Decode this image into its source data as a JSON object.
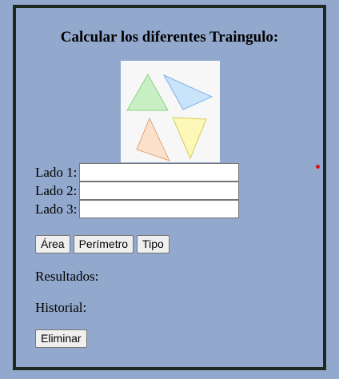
{
  "title": "Calcular los diferentes Traingulo:",
  "fields": [
    {
      "label": "Lado 1:",
      "value": ""
    },
    {
      "label": "Lado 2:",
      "value": ""
    },
    {
      "label": "Lado 3:",
      "value": ""
    }
  ],
  "buttons": {
    "area": "Área",
    "perimeter": "Perímetro",
    "type": "Tipo",
    "delete": "Eliminar"
  },
  "results_label": "Resultados:",
  "history_label": "Historial:",
  "image": {
    "icon": "triangles-illustration",
    "colors": {
      "green": "#c9f0c4",
      "blue": "#c9e3fb",
      "orange": "#fbe1cc",
      "yellow": "#fbf8b8"
    }
  },
  "colors": {
    "background": "#92a8cc",
    "border": "#1d2a20",
    "marker": "#d11a1a"
  }
}
